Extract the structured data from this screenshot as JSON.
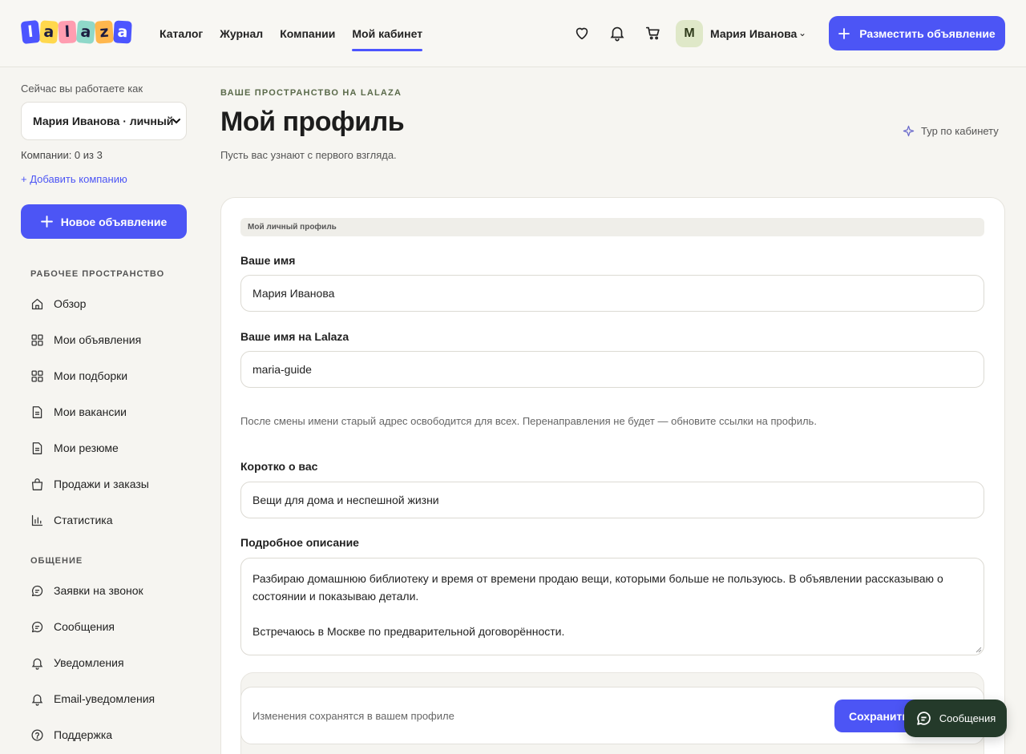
{
  "header": {
    "logo_letters": [
      "l",
      "a",
      "l",
      "a",
      "z",
      "a"
    ],
    "nav": [
      "Каталог",
      "Журнал",
      "Компании",
      "Мой кабинет"
    ],
    "user_initial": "M",
    "user_name": "Мария Иванова",
    "user_caret": "⌄",
    "post_button": "Разместить объявление"
  },
  "sidebar": {
    "hint": "Сейчас вы работаете как",
    "account_select": "Мария Иванова · личный",
    "companies": "Компании: 0 из 3",
    "add_company": "+ Добавить компанию",
    "new_listing": "Новое объявление",
    "workspace_title": "РАБОЧЕЕ ПРОСТРАНСТВО",
    "workspace_items": [
      {
        "label": "Обзор",
        "icon": "home-icon"
      },
      {
        "label": "Мои объявления",
        "icon": "grid-icon"
      },
      {
        "label": "Мои подборки",
        "icon": "grid-icon"
      },
      {
        "label": "Мои вакансии",
        "icon": "document-icon"
      },
      {
        "label": "Мои резюме",
        "icon": "document-icon"
      },
      {
        "label": "Продажи и заказы",
        "icon": "bag-icon"
      },
      {
        "label": "Статистика",
        "icon": "chart-icon"
      }
    ],
    "communication_title": "ОБЩЕНИЕ",
    "communication_items": [
      {
        "label": "Заявки на звонок",
        "icon": "chat-icon"
      },
      {
        "label": "Сообщения",
        "icon": "chat-icon"
      },
      {
        "label": "Уведомления",
        "icon": "bell-icon"
      },
      {
        "label": "Email-уведомления",
        "icon": "bell-icon"
      },
      {
        "label": "Поддержка",
        "icon": "help-icon"
      }
    ]
  },
  "main": {
    "eyebrow": "ВАШЕ ПРОСТРАНСТВО НА LALAZA",
    "title": "Мой профиль",
    "subtitle": "Пусть вас узнают с первого взгляда.",
    "tour": "Тур по кабинету",
    "profile_chip": "Мой личный профиль",
    "name_label": "Ваше имя",
    "name_value": "Мария Иванова",
    "handle_label": "Ваше имя на Lalaza",
    "handle_value": "maria-guide",
    "handle_note": "После смены имени старый адрес освободится для всех. Перенаправления не будет — обновите ссылки на профиль.",
    "about_label": "Коротко о вас",
    "about_value": "Вещи для дома и неспешной жизни",
    "description_label": "Подробное описание",
    "description_p1": "Разбираю домашнюю библиотеку и время от времени продаю вещи, которыми больше не пользуюсь. В объявлении рассказываю о состоянии и показываю детали.",
    "description_p2": "Встречаюсь в Москве по предварительной договорённости.",
    "save_hint": "Изменения сохранятся в вашем профиле",
    "save_button": "Сохранить"
  },
  "messages_fab": "Сообщения",
  "colors": {
    "accent": "#4c55f5",
    "fab": "#243a2a",
    "background": "#f6f5f1"
  }
}
